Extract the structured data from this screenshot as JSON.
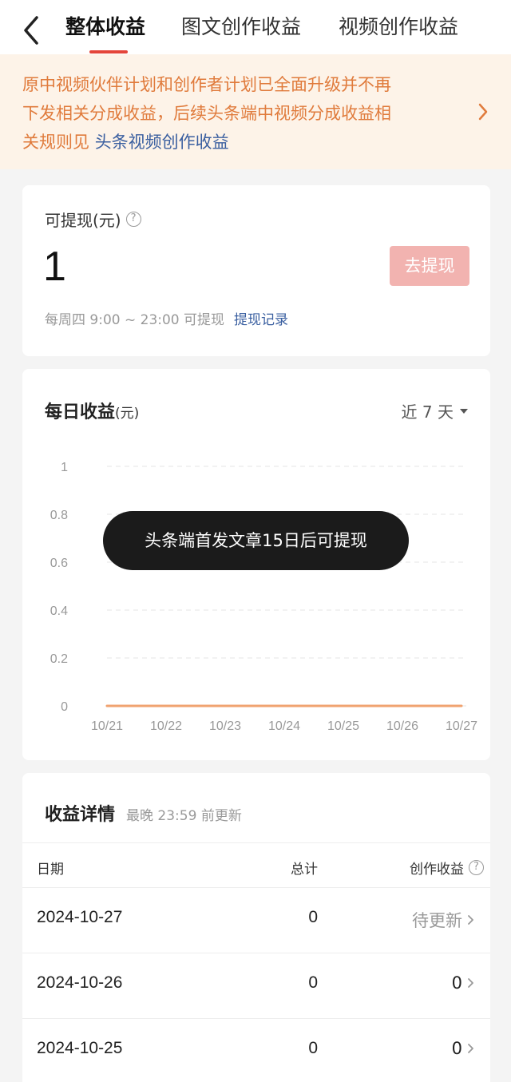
{
  "header": {
    "tabs": [
      {
        "label": "整体收益",
        "active": true
      },
      {
        "label": "图文创作收益",
        "active": false
      },
      {
        "label": "视频创作收益",
        "active": false
      }
    ],
    "back_icon": "chevron-left-icon"
  },
  "notice": {
    "text_line1": "原中视频伙伴计划和创作者计划已全面升级并不再",
    "text_line2": "下发相关分成收益，后续头条端中视频分成收益相",
    "text_line3_prefix": "关规则见 ",
    "link": "头条视频创作收益",
    "color": "#e07b3c"
  },
  "withdraw": {
    "label": "可提现(元)",
    "amount": "1",
    "button_label": "去提现",
    "hint": "每周四 9:00 ~ 23:00 可提现",
    "record_link": "提现记录"
  },
  "daily": {
    "title": "每日收益",
    "unit": "(元)",
    "range_label": "近 7 天"
  },
  "chart_data": {
    "type": "line",
    "categories": [
      "10/21",
      "10/22",
      "10/23",
      "10/24",
      "10/25",
      "10/26",
      "10/27"
    ],
    "series": [
      {
        "values": [
          0,
          0,
          0,
          0,
          0,
          0,
          0
        ],
        "color": "#f0a370"
      }
    ],
    "y_ticks": [
      "1",
      "0.8",
      "0.6",
      "0.4",
      "0.2",
      "0"
    ],
    "ylim": [
      0,
      1
    ],
    "grid": true,
    "title": "",
    "xlabel": "",
    "ylabel": ""
  },
  "toast": {
    "text": "头条端首发文章15日后可提现"
  },
  "details": {
    "title": "收益详情",
    "subtitle": "最晚 23:59 前更新",
    "columns": {
      "date": "日期",
      "total": "总计",
      "creation": "创作收益"
    },
    "rows": [
      {
        "date": "2024-10-27",
        "total": "0",
        "creation": "待更新",
        "pending": true
      },
      {
        "date": "2024-10-26",
        "total": "0",
        "creation": "0",
        "pending": false
      },
      {
        "date": "2024-10-25",
        "total": "0",
        "creation": "0",
        "pending": false
      }
    ]
  }
}
